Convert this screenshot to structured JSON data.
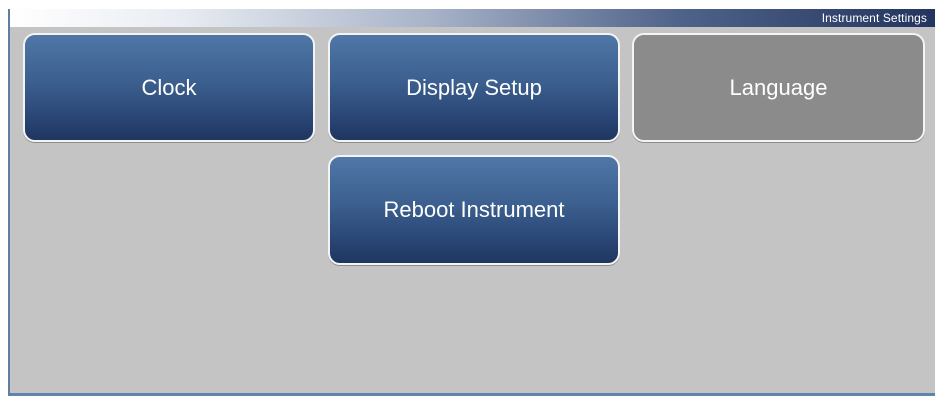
{
  "header": {
    "title": "Instrument Settings"
  },
  "menu": {
    "clock_label": "Clock",
    "display_setup_label": "Display Setup",
    "language_label": "Language",
    "reboot_label": "Reboot Instrument"
  },
  "colors": {
    "button_gradient_top": "#4f77a7",
    "button_gradient_bottom": "#1f365f",
    "disabled_button": "#8b8b8b",
    "background": "#c4c4c4",
    "title_bar_dark": "#23355f"
  }
}
